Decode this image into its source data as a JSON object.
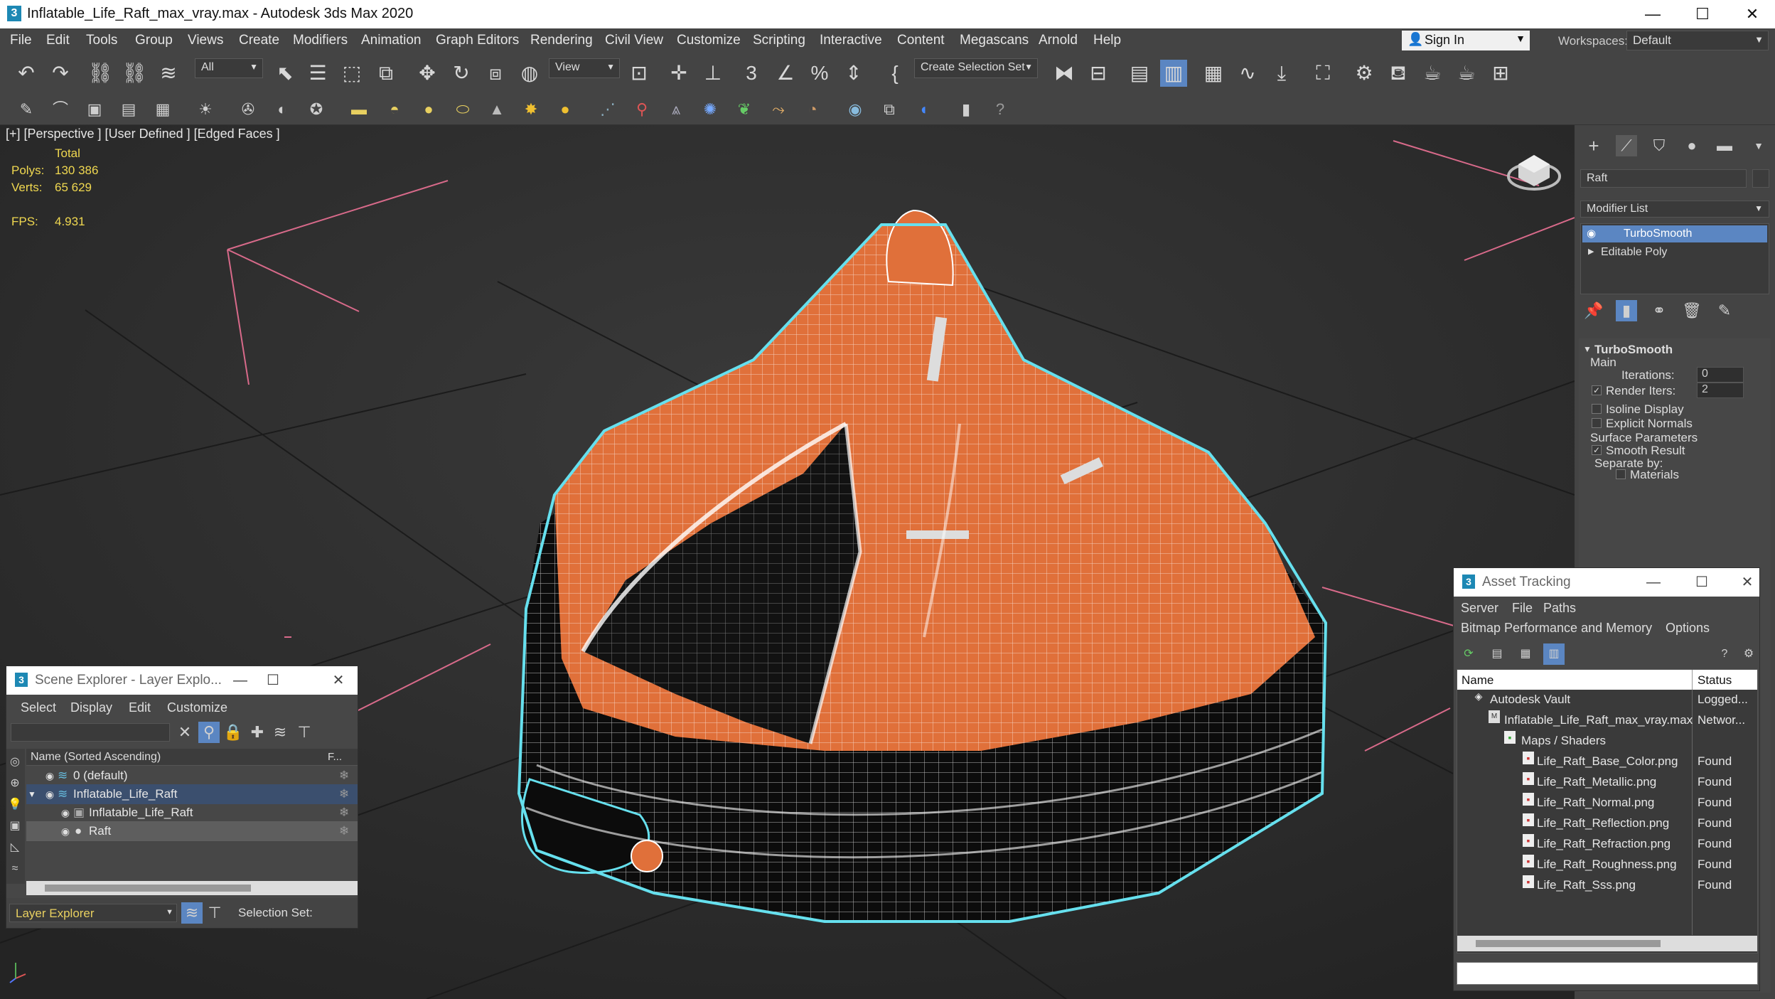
{
  "window": {
    "title": "Inflatable_Life_Raft_max_vray.max - Autodesk 3ds Max 2020",
    "logo": "3"
  },
  "menu": [
    "File",
    "Edit",
    "Tools",
    "Group",
    "Views",
    "Create",
    "Modifiers",
    "Animation",
    "Graph Editors",
    "Rendering",
    "Civil View",
    "Customize",
    "Scripting",
    "Interactive",
    "Content",
    "Megascans",
    "Arnold",
    "Help"
  ],
  "account": {
    "sign_in": "Sign In",
    "workspaces_label": "Workspaces:",
    "workspace": "Default"
  },
  "toolbar": {
    "filter": "All",
    "ref_coord": "View",
    "selection_set": "Create Selection Set"
  },
  "viewport": {
    "label": "[+] [Perspective ] [User Defined ] [Edged Faces ]",
    "stats": {
      "header": "Total",
      "polys_label": "Polys:",
      "polys": "130 386",
      "verts_label": "Verts:",
      "verts": "65 629",
      "fps_label": "FPS:",
      "fps": "4.931"
    }
  },
  "command_panel": {
    "object_name": "Raft",
    "modifier_list": "Modifier List",
    "stack": [
      "TurboSmooth",
      "Editable Poly"
    ],
    "rollout": {
      "title": "TurboSmooth",
      "main": "Main",
      "iterations_label": "Iterations:",
      "iterations": "0",
      "render_iters_label": "Render Iters:",
      "render_iters": "2",
      "isoline": "Isoline Display",
      "explicit_normals": "Explicit Normals",
      "surface_params": "Surface Parameters",
      "smooth_result": "Smooth Result",
      "separate_by": "Separate by:",
      "materials": "Materials"
    }
  },
  "scene_explorer": {
    "title": "Scene Explorer - Layer Explo...",
    "menu": [
      "Select",
      "Display",
      "Edit",
      "Customize"
    ],
    "header": "Name (Sorted Ascending)",
    "header_f": "F...",
    "rows": [
      "0 (default)",
      "Inflatable_Life_Raft",
      "Inflatable_Life_Raft",
      "Raft"
    ],
    "footer_mode": "Layer Explorer",
    "footer_selset": "Selection Set:"
  },
  "asset_tracking": {
    "title": "Asset Tracking",
    "menu": [
      "Server",
      "File",
      "Paths"
    ],
    "menu2": [
      "Bitmap Performance and Memory",
      "Options"
    ],
    "col_name": "Name",
    "col_status": "Status",
    "rows": [
      {
        "name": "Autodesk Vault",
        "status": "Logged..."
      },
      {
        "name": "Inflatable_Life_Raft_max_vray.max",
        "status": "Networ..."
      },
      {
        "name": "Maps / Shaders",
        "status": ""
      },
      {
        "name": "Life_Raft_Base_Color.png",
        "status": "Found"
      },
      {
        "name": "Life_Raft_Metallic.png",
        "status": "Found"
      },
      {
        "name": "Life_Raft_Normal.png",
        "status": "Found"
      },
      {
        "name": "Life_Raft_Reflection.png",
        "status": "Found"
      },
      {
        "name": "Life_Raft_Refraction.png",
        "status": "Found"
      },
      {
        "name": "Life_Raft_Roughness.png",
        "status": "Found"
      },
      {
        "name": "Life_Raft_Sss.png",
        "status": "Found"
      }
    ]
  },
  "colors": {
    "accent": "#4a7fc4",
    "selection_outline": "#66e0ee",
    "raft_orange": "#e0703a",
    "stat_yellow": "#f0d850"
  }
}
